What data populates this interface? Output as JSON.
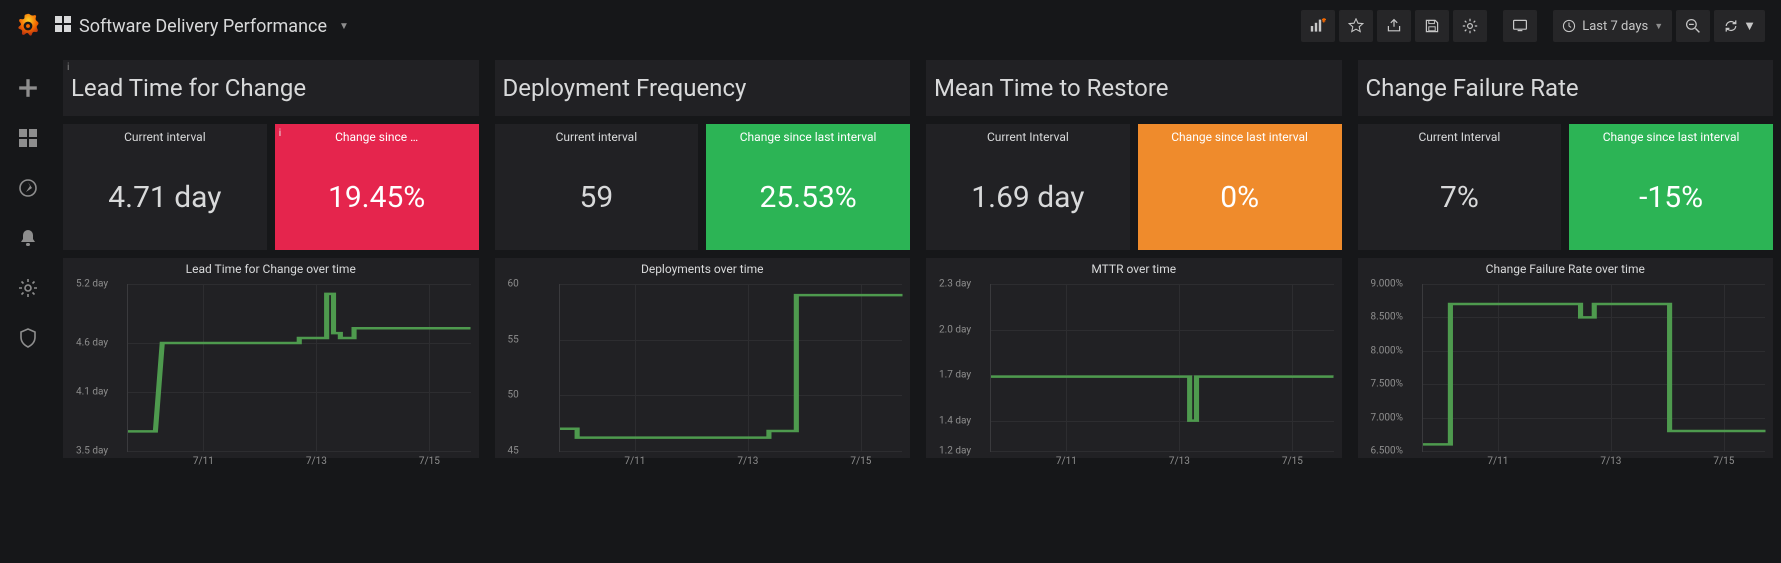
{
  "navbar": {
    "dashboard_title": "Software Delivery Performance",
    "time_range": "Last 7 days"
  },
  "metrics": [
    {
      "title": "Lead Time for Change",
      "current_label": "Current interval",
      "current_value": "4.71 day",
      "change_label": "Change since …",
      "change_value": "19.45%",
      "change_color": "red",
      "chart_title": "Lead Time for Change over time"
    },
    {
      "title": "Deployment Frequency",
      "current_label": "Current interval",
      "current_value": "59",
      "change_label": "Change since last interval",
      "change_value": "25.53%",
      "change_color": "green",
      "chart_title": "Deployments over time"
    },
    {
      "title": "Mean Time to Restore",
      "current_label": "Current Interval",
      "current_value": "1.69 day",
      "change_label": "Change since last interval",
      "change_value": "0%",
      "change_color": "orange",
      "chart_title": "MTTR over time"
    },
    {
      "title": "Change Failure Rate",
      "current_label": "Current Interval",
      "current_value": "7%",
      "change_label": "Change since last interval",
      "change_value": "-15%",
      "change_color": "green",
      "chart_title": "Change Failure Rate over time"
    }
  ],
  "chart_data": [
    {
      "type": "line",
      "title": "Lead Time for Change over time",
      "xlabel": "",
      "ylabel": "",
      "yticks": [
        "3.5 day",
        "4.1 day",
        "4.6 day",
        "5.2 day"
      ],
      "xticks": [
        "7/11",
        "7/13",
        "7/15"
      ],
      "ylim": [
        3.5,
        5.2
      ],
      "x": [
        0,
        0.08,
        0.1,
        0.5,
        0.5,
        0.58,
        0.58,
        0.6,
        0.6,
        0.62,
        0.62,
        0.66,
        0.66,
        1.0
      ],
      "values": [
        3.7,
        3.7,
        4.6,
        4.6,
        4.65,
        4.65,
        5.1,
        5.1,
        4.7,
        4.7,
        4.65,
        4.65,
        4.75,
        4.75
      ]
    },
    {
      "type": "line",
      "title": "Deployments over time",
      "xlabel": "",
      "ylabel": "",
      "yticks": [
        "45",
        "50",
        "55",
        "60"
      ],
      "xticks": [
        "7/11",
        "7/13",
        "7/15"
      ],
      "ylim": [
        45,
        60
      ],
      "x": [
        0,
        0.05,
        0.05,
        0.61,
        0.61,
        0.69,
        0.69,
        1.0
      ],
      "values": [
        47,
        47,
        46.2,
        46.2,
        46.8,
        46.8,
        59,
        59
      ]
    },
    {
      "type": "line",
      "title": "MTTR over time",
      "xlabel": "",
      "ylabel": "",
      "yticks": [
        "1.2 day",
        "1.4 day",
        "1.7 day",
        "2.0 day",
        "2.3 day"
      ],
      "xticks": [
        "7/11",
        "7/13",
        "7/15"
      ],
      "ylim": [
        1.2,
        2.3
      ],
      "x": [
        0,
        0.58,
        0.58,
        0.6,
        0.6,
        1.0
      ],
      "values": [
        1.69,
        1.69,
        1.4,
        1.4,
        1.69,
        1.69
      ]
    },
    {
      "type": "line",
      "title": "Change Failure Rate over time",
      "xlabel": "",
      "ylabel": "",
      "yticks": [
        "6.500%",
        "7.000%",
        "7.500%",
        "8.000%",
        "8.500%",
        "9.000%"
      ],
      "xticks": [
        "7/11",
        "7/13",
        "7/15"
      ],
      "ylim": [
        6.5,
        9.0
      ],
      "x": [
        0,
        0.08,
        0.08,
        0.46,
        0.46,
        0.5,
        0.5,
        0.72,
        0.72,
        1.0
      ],
      "values": [
        6.6,
        6.6,
        8.7,
        8.7,
        8.5,
        8.5,
        8.7,
        8.7,
        6.8,
        6.8
      ]
    }
  ]
}
